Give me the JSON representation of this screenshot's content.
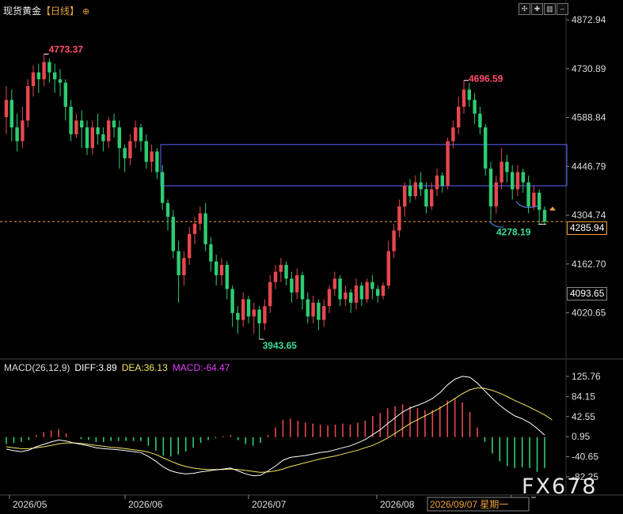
{
  "header": {
    "instrument": "现货黄金",
    "period": "【日线】",
    "toolbar_icons": [
      "crosshair-icon",
      "zoom-icon",
      "bar-chart-icon",
      "minimize-icon",
      "close-icon"
    ]
  },
  "price_axis": {
    "ticks": [
      "4872.94",
      "4730.89",
      "4588.84",
      "4446.79",
      "4304.74",
      "4162.70",
      "4020.65"
    ],
    "current_price": "4285.94",
    "cursor_price": "4093.65"
  },
  "annotations": {
    "high_label": "4773.37",
    "mid_high_label": "4696.59",
    "low_label": "3943.65",
    "recent_low_label": "4278.19"
  },
  "macd": {
    "title": "MACD(26,12,9)",
    "diff_label": "DIFF:3.89",
    "dea_label": "DEA:36.13",
    "macd_label": "MACD:-64.47",
    "ticks": [
      "125.76",
      "84.15",
      "42.55",
      "0.95",
      "-40.65",
      "-82.25"
    ]
  },
  "time_axis": {
    "labels": [
      "2026/05",
      "2026/06",
      "2026/07",
      "2026/08",
      "/09"
    ],
    "cursor_date": "2026/09/07 星期一"
  },
  "watermark": "FX678",
  "colors": {
    "up": "#e5484d",
    "down": "#2ecc71",
    "diff_line": "#ffffff",
    "dea_line": "#f5e663",
    "macd_text": "#e040fb",
    "box": "#5b63ff",
    "current_line": "#f0a23a",
    "high_label": "#ff4d6a",
    "low_label": "#3ddc97"
  },
  "chart_data": {
    "type": "candlestick",
    "title": "现货黄金【日线】",
    "ylim": [
      3900,
      4880
    ],
    "x_labels": [
      "2026/05",
      "2026/06",
      "2026/07",
      "2026/08",
      "/09"
    ],
    "candles": [
      [
        4590,
        4640,
        4540,
        4680
      ],
      [
        4640,
        4560,
        4520,
        4670
      ],
      [
        4560,
        4520,
        4490,
        4600
      ],
      [
        4520,
        4580,
        4500,
        4620
      ],
      [
        4580,
        4680,
        4560,
        4700
      ],
      [
        4680,
        4720,
        4650,
        4740
      ],
      [
        4720,
        4700,
        4660,
        4745
      ],
      [
        4700,
        4750,
        4680,
        4773
      ],
      [
        4750,
        4720,
        4690,
        4760
      ],
      [
        4720,
        4700,
        4660,
        4745
      ],
      [
        4700,
        4690,
        4650,
        4730
      ],
      [
        4690,
        4620,
        4580,
        4700
      ],
      [
        4620,
        4540,
        4520,
        4640
      ],
      [
        4540,
        4580,
        4530,
        4600
      ],
      [
        4580,
        4560,
        4500,
        4610
      ],
      [
        4560,
        4500,
        4480,
        4580
      ],
      [
        4500,
        4560,
        4480,
        4580
      ],
      [
        4560,
        4540,
        4510,
        4600
      ],
      [
        4540,
        4520,
        4490,
        4560
      ],
      [
        4520,
        4580,
        4500,
        4590
      ],
      [
        4580,
        4560,
        4530,
        4600
      ],
      [
        4560,
        4500,
        4440,
        4580
      ],
      [
        4500,
        4470,
        4430,
        4510
      ],
      [
        4470,
        4520,
        4450,
        4540
      ],
      [
        4520,
        4560,
        4500,
        4580
      ],
      [
        4560,
        4520,
        4490,
        4570
      ],
      [
        4520,
        4460,
        4440,
        4540
      ],
      [
        4460,
        4490,
        4430,
        4510
      ],
      [
        4490,
        4430,
        4410,
        4500
      ],
      [
        4430,
        4340,
        4320,
        4450
      ],
      [
        4340,
        4300,
        4260,
        4350
      ],
      [
        4300,
        4200,
        4180,
        4320
      ],
      [
        4200,
        4130,
        4050,
        4230
      ],
      [
        4130,
        4180,
        4100,
        4200
      ],
      [
        4180,
        4250,
        4160,
        4270
      ],
      [
        4250,
        4280,
        4220,
        4300
      ],
      [
        4280,
        4310,
        4260,
        4330
      ],
      [
        4310,
        4220,
        4200,
        4340
      ],
      [
        4220,
        4170,
        4140,
        4240
      ],
      [
        4170,
        4130,
        4100,
        4190
      ],
      [
        4130,
        4160,
        4100,
        4180
      ],
      [
        4160,
        4090,
        4060,
        4170
      ],
      [
        4090,
        4020,
        3980,
        4100
      ],
      [
        4020,
        4000,
        3960,
        4040
      ],
      [
        4000,
        4060,
        3980,
        4080
      ],
      [
        4060,
        4010,
        3990,
        4070
      ],
      [
        4010,
        4030,
        3960,
        4050
      ],
      [
        4030,
        3990,
        3944,
        4040
      ],
      [
        3990,
        4040,
        3970,
        4060
      ],
      [
        4040,
        4110,
        4020,
        4130
      ],
      [
        4110,
        4140,
        4090,
        4160
      ],
      [
        4140,
        4160,
        4110,
        4180
      ],
      [
        4160,
        4120,
        4100,
        4170
      ],
      [
        4120,
        4080,
        4050,
        4140
      ],
      [
        4080,
        4130,
        4060,
        4150
      ],
      [
        4130,
        4060,
        4030,
        4140
      ],
      [
        4060,
        4010,
        3990,
        4080
      ],
      [
        4010,
        4050,
        3990,
        4070
      ],
      [
        4050,
        4000,
        3970,
        4060
      ],
      [
        4000,
        4040,
        3980,
        4060
      ],
      [
        4040,
        4090,
        4020,
        4100
      ],
      [
        4090,
        4120,
        4070,
        4140
      ],
      [
        4120,
        4060,
        4040,
        4130
      ],
      [
        4060,
        4080,
        4040,
        4100
      ],
      [
        4080,
        4050,
        4020,
        4090
      ],
      [
        4050,
        4100,
        4030,
        4120
      ],
      [
        4100,
        4060,
        4040,
        4110
      ],
      [
        4060,
        4110,
        4050,
        4120
      ],
      [
        4110,
        4090,
        4060,
        4130
      ],
      [
        4090,
        4070,
        4050,
        4100
      ],
      [
        4070,
        4100,
        4060,
        4110
      ],
      [
        4100,
        4200,
        4090,
        4230
      ],
      [
        4200,
        4260,
        4180,
        4280
      ],
      [
        4260,
        4330,
        4240,
        4350
      ],
      [
        4330,
        4390,
        4300,
        4400
      ],
      [
        4390,
        4360,
        4340,
        4410
      ],
      [
        4360,
        4400,
        4350,
        4420
      ],
      [
        4400,
        4380,
        4360,
        4430
      ],
      [
        4380,
        4330,
        4310,
        4400
      ],
      [
        4330,
        4380,
        4320,
        4400
      ],
      [
        4380,
        4420,
        4360,
        4440
      ],
      [
        4420,
        4390,
        4370,
        4430
      ],
      [
        4390,
        4520,
        4380,
        4530
      ],
      [
        4520,
        4560,
        4500,
        4580
      ],
      [
        4560,
        4620,
        4540,
        4650
      ],
      [
        4620,
        4670,
        4600,
        4697
      ],
      [
        4670,
        4640,
        4620,
        4690
      ],
      [
        4640,
        4600,
        4570,
        4660
      ],
      [
        4600,
        4560,
        4540,
        4620
      ],
      [
        4560,
        4440,
        4420,
        4570
      ],
      [
        4440,
        4330,
        4290,
        4460
      ],
      [
        4330,
        4400,
        4310,
        4420
      ],
      [
        4400,
        4460,
        4380,
        4500
      ],
      [
        4460,
        4430,
        4400,
        4480
      ],
      [
        4430,
        4380,
        4350,
        4450
      ],
      [
        4380,
        4430,
        4360,
        4450
      ],
      [
        4430,
        4400,
        4370,
        4440
      ],
      [
        4400,
        4330,
        4310,
        4420
      ],
      [
        4330,
        4370,
        4320,
        4390
      ],
      [
        4370,
        4320,
        4280,
        4380
      ],
      [
        4320,
        4286,
        4278,
        4330
      ]
    ],
    "macd": {
      "ylim": [
        -82.25,
        125.76
      ],
      "diff": [
        -25,
        -28,
        -30,
        -27,
        -20,
        -15,
        -10,
        -6,
        -8,
        -12,
        -15,
        -18,
        -22,
        -24,
        -25,
        -26,
        -28,
        -30,
        -32,
        -40,
        -50,
        -62,
        -70,
        -74,
        -76,
        -75,
        -72,
        -70,
        -68,
        -66,
        -64,
        -70,
        -76,
        -80,
        -79,
        -70,
        -60,
        -48,
        -42,
        -40,
        -38,
        -35,
        -32,
        -30,
        -26,
        -22,
        -18,
        -12,
        -5,
        5,
        15,
        28,
        40,
        52,
        60,
        66,
        72,
        80,
        92,
        108,
        120,
        126,
        124,
        112,
        96,
        80,
        66,
        54,
        44,
        38,
        30,
        18,
        4
      ],
      "dea": [
        -20,
        -22,
        -24,
        -24,
        -22,
        -20,
        -17,
        -14,
        -12,
        -12,
        -13,
        -15,
        -17,
        -19,
        -21,
        -22,
        -24,
        -26,
        -28,
        -31,
        -36,
        -43,
        -50,
        -56,
        -61,
        -64,
        -66,
        -67,
        -67,
        -67,
        -66,
        -67,
        -69,
        -71,
        -73,
        -72,
        -70,
        -66,
        -61,
        -57,
        -53,
        -49,
        -45,
        -42,
        -39,
        -35,
        -31,
        -27,
        -22,
        -17,
        -10,
        -2,
        8,
        18,
        28,
        36,
        44,
        52,
        60,
        70,
        80,
        90,
        98,
        102,
        101,
        97,
        91,
        84,
        76,
        69,
        62,
        54,
        46,
        36
      ],
      "hist": [
        -14,
        -12,
        -10,
        -6,
        4,
        10,
        14,
        16,
        8,
        0,
        -4,
        -6,
        -10,
        -10,
        -8,
        -8,
        -8,
        -8,
        -8,
        -18,
        -28,
        -38,
        -40,
        -36,
        -30,
        -22,
        -12,
        -6,
        -2,
        2,
        4,
        -6,
        -14,
        -18,
        -12,
        4,
        20,
        36,
        38,
        34,
        30,
        28,
        26,
        24,
        26,
        28,
        26,
        30,
        34,
        44,
        50,
        60,
        64,
        68,
        64,
        60,
        56,
        56,
        64,
        76,
        80,
        72,
        52,
        20,
        -10,
        -34,
        -50,
        -60,
        -64,
        -62,
        -64,
        -72,
        -64
      ]
    }
  }
}
